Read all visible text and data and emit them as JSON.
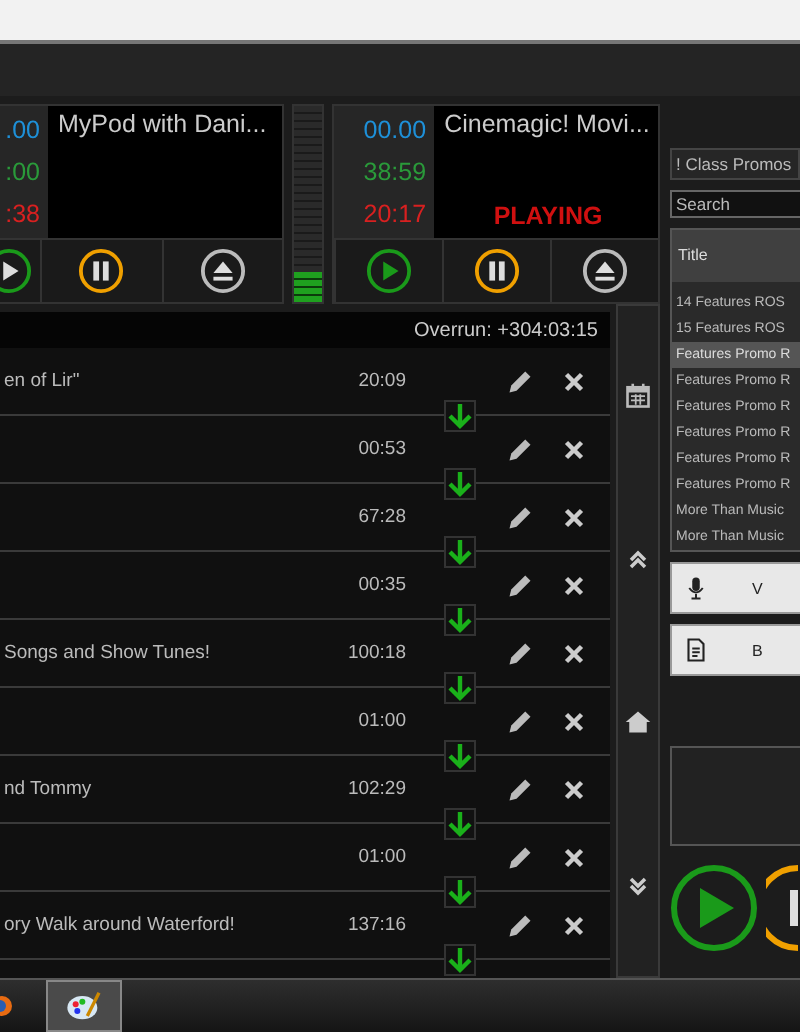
{
  "decks": [
    {
      "times": [
        ".00",
        ":00",
        ":38"
      ],
      "title": "MyPod with Dani..."
    },
    {
      "times": [
        "00.00",
        "38:59",
        "20:17"
      ],
      "title": "Cinemagic! Movi...",
      "status": "PLAYING"
    }
  ],
  "meter": {
    "level": 0.15
  },
  "overrun": "Overrun: +304:03:15",
  "playlist": [
    {
      "title": "en of Lir\"",
      "duration": "20:09"
    },
    {
      "duration": "00:53"
    },
    {
      "duration": "67:28"
    },
    {
      "duration": "00:35"
    },
    {
      "title": "Songs and Show Tunes!",
      "duration": "100:18"
    },
    {
      "duration": "01:00"
    },
    {
      "title": "nd Tommy",
      "duration": "102:29"
    },
    {
      "duration": "01:00"
    },
    {
      "title": "ory Walk around Waterford!",
      "duration": "137:16"
    }
  ],
  "library": {
    "category": "! Class Promos",
    "search": {
      "placeholder": "Search"
    },
    "column": "Title",
    "items": [
      {
        "label": "14 Features ROS",
        "selected": false
      },
      {
        "label": "15 Features ROS",
        "selected": false
      },
      {
        "label": "Features Promo R",
        "selected": true
      },
      {
        "label": "Features Promo R",
        "selected": false
      },
      {
        "label": "Features Promo R",
        "selected": false
      },
      {
        "label": "Features Promo R",
        "selected": false
      },
      {
        "label": "Features Promo R",
        "selected": false
      },
      {
        "label": "Features Promo R",
        "selected": false
      },
      {
        "label": "More Than Music",
        "selected": false
      },
      {
        "label": "More Than Music",
        "selected": false
      }
    ],
    "buttons": [
      {
        "kind": "mic",
        "label": "V"
      },
      {
        "kind": "doc",
        "label": "B"
      }
    ]
  }
}
